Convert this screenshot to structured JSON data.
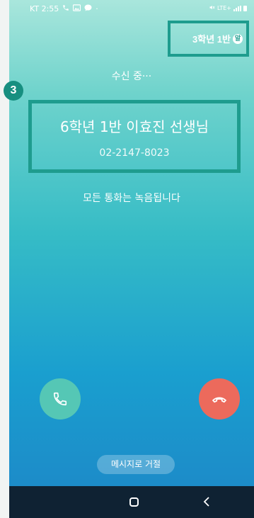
{
  "status_bar": {
    "carrier_time": "KT 2:55",
    "dot": "·",
    "network_label": "LTE+"
  },
  "class_tag": {
    "label": "3학년 1반",
    "badge": "알"
  },
  "call": {
    "status": "수신 중···",
    "caller_name": "6학년 1반 이효진 선생님",
    "caller_number": "02-2147-8023",
    "recording_notice": "모든 통화는 녹음됩니다"
  },
  "step_marker": "3",
  "actions": {
    "accept_icon": "phone-icon",
    "decline_icon": "phone-hangup-icon",
    "reject_with_message": "메시지로 거절"
  },
  "nav": {
    "home_icon": "home-icon",
    "back_icon": "back-chevron-icon"
  },
  "colors": {
    "accent_box": "#1e9c8e",
    "accept": "#55c7b5",
    "decline": "#ec6a5c",
    "navbar": "#0f2233"
  }
}
